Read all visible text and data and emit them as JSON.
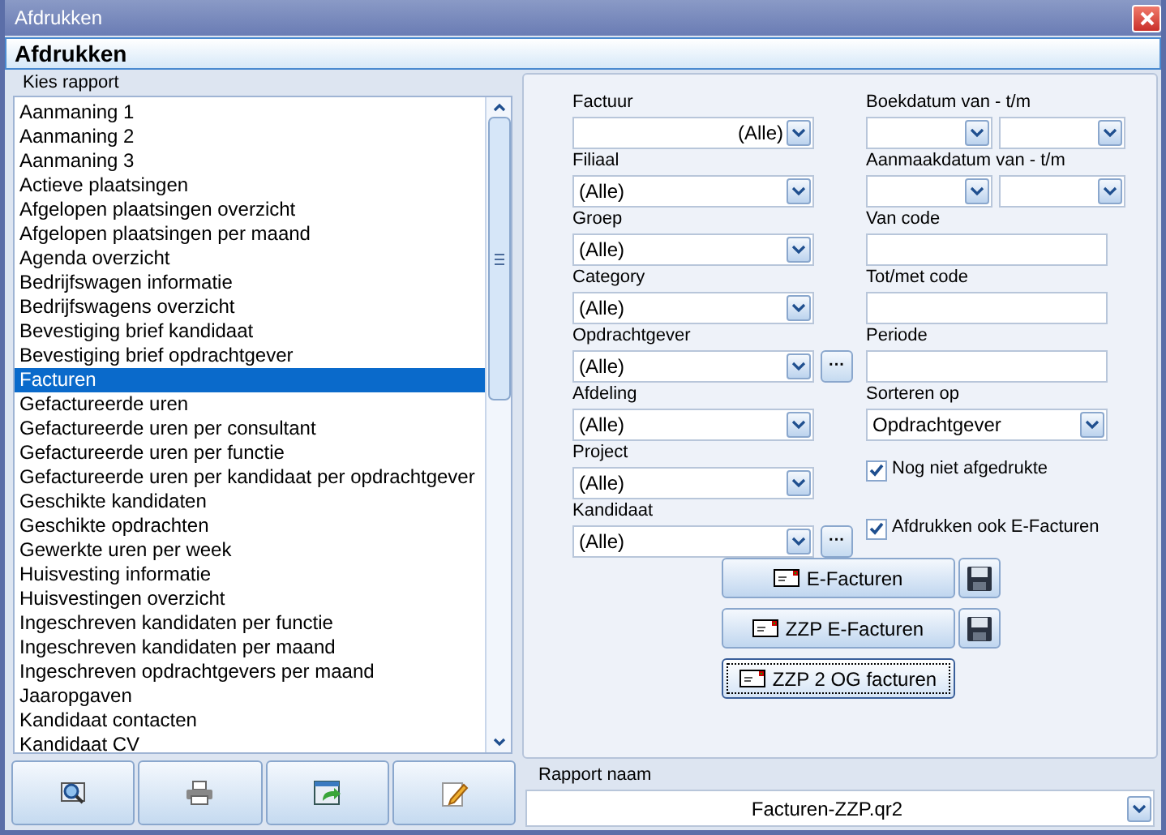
{
  "window": {
    "title": "Afdrukken"
  },
  "header": "Afdrukken",
  "report_list": {
    "label": "Kies rapport",
    "items": [
      {
        "label": "Aanmaning 1",
        "selected": false
      },
      {
        "label": "Aanmaning 2",
        "selected": false
      },
      {
        "label": "Aanmaning 3",
        "selected": false
      },
      {
        "label": "Actieve plaatsingen",
        "selected": false
      },
      {
        "label": "Afgelopen plaatsingen overzicht",
        "selected": false
      },
      {
        "label": "Afgelopen plaatsingen per maand",
        "selected": false
      },
      {
        "label": "Agenda overzicht",
        "selected": false
      },
      {
        "label": "Bedrijfswagen informatie",
        "selected": false
      },
      {
        "label": "Bedrijfswagens overzicht",
        "selected": false
      },
      {
        "label": "Bevestiging brief kandidaat",
        "selected": false
      },
      {
        "label": "Bevestiging brief opdrachtgever",
        "selected": false
      },
      {
        "label": "Facturen",
        "selected": true
      },
      {
        "label": "Gefactureerde uren",
        "selected": false
      },
      {
        "label": "Gefactureerde uren per consultant",
        "selected": false
      },
      {
        "label": "Gefactureerde uren per functie",
        "selected": false
      },
      {
        "label": "Gefactureerde uren per kandidaat per opdrachtgever",
        "selected": false
      },
      {
        "label": "Geschikte kandidaten",
        "selected": false
      },
      {
        "label": "Geschikte opdrachten",
        "selected": false
      },
      {
        "label": "Gewerkte uren per week",
        "selected": false
      },
      {
        "label": "Huisvesting informatie",
        "selected": false
      },
      {
        "label": "Huisvestingen overzicht",
        "selected": false
      },
      {
        "label": "Ingeschreven kandidaten per functie",
        "selected": false
      },
      {
        "label": "Ingeschreven kandidaten per maand",
        "selected": false
      },
      {
        "label": "Ingeschreven opdrachtgevers per maand",
        "selected": false
      },
      {
        "label": "Jaaropgaven",
        "selected": false
      },
      {
        "label": "Kandidaat contacten",
        "selected": false
      },
      {
        "label": "Kandidaat CV",
        "selected": false
      }
    ]
  },
  "filters_left": [
    {
      "kind": "combo_right",
      "label": "Factuur",
      "value": "(Alle)"
    },
    {
      "kind": "combo",
      "label": "Filiaal",
      "value": "(Alle)"
    },
    {
      "kind": "combo",
      "label": "Groep",
      "value": "(Alle)"
    },
    {
      "kind": "combo",
      "label": "Category",
      "value": "(Alle)"
    },
    {
      "kind": "combo",
      "label": "Opdrachtgever",
      "value": "(Alle)",
      "lookup_button": "···"
    },
    {
      "kind": "combo",
      "label": "Afdeling",
      "value": "(Alle)"
    },
    {
      "kind": "combo",
      "label": "Project",
      "value": "(Alle)"
    },
    {
      "kind": "combo",
      "label": "Kandidaat",
      "value": "(Alle)",
      "lookup_button": "···"
    }
  ],
  "filters_right": [
    {
      "kind": "date_range",
      "label": "Boekdatum van - t/m"
    },
    {
      "kind": "date_range",
      "label": "Aanmaakdatum van - t/m"
    },
    {
      "kind": "text",
      "label": "Van code"
    },
    {
      "kind": "text",
      "label": "Tot/met code"
    },
    {
      "kind": "text",
      "label": "Periode"
    },
    {
      "kind": "combo",
      "label": "Sorteren op",
      "value": "Opdrachtgever"
    },
    {
      "kind": "checkbox",
      "label": "Nog niet afgedrukte",
      "checked": true
    },
    {
      "kind": "checkbox",
      "label": "Afdrukken ook E-Facturen",
      "checked": true
    }
  ],
  "action_buttons": [
    {
      "label": "E-Facturen",
      "save": true,
      "focused": false
    },
    {
      "label": "ZZP E-Facturen",
      "save": true,
      "focused": false
    },
    {
      "label": "ZZP 2 OG facturen",
      "save": false,
      "focused": true
    }
  ],
  "report_name": {
    "label": "Rapport naam",
    "value": "Facturen-ZZP.qr2"
  }
}
